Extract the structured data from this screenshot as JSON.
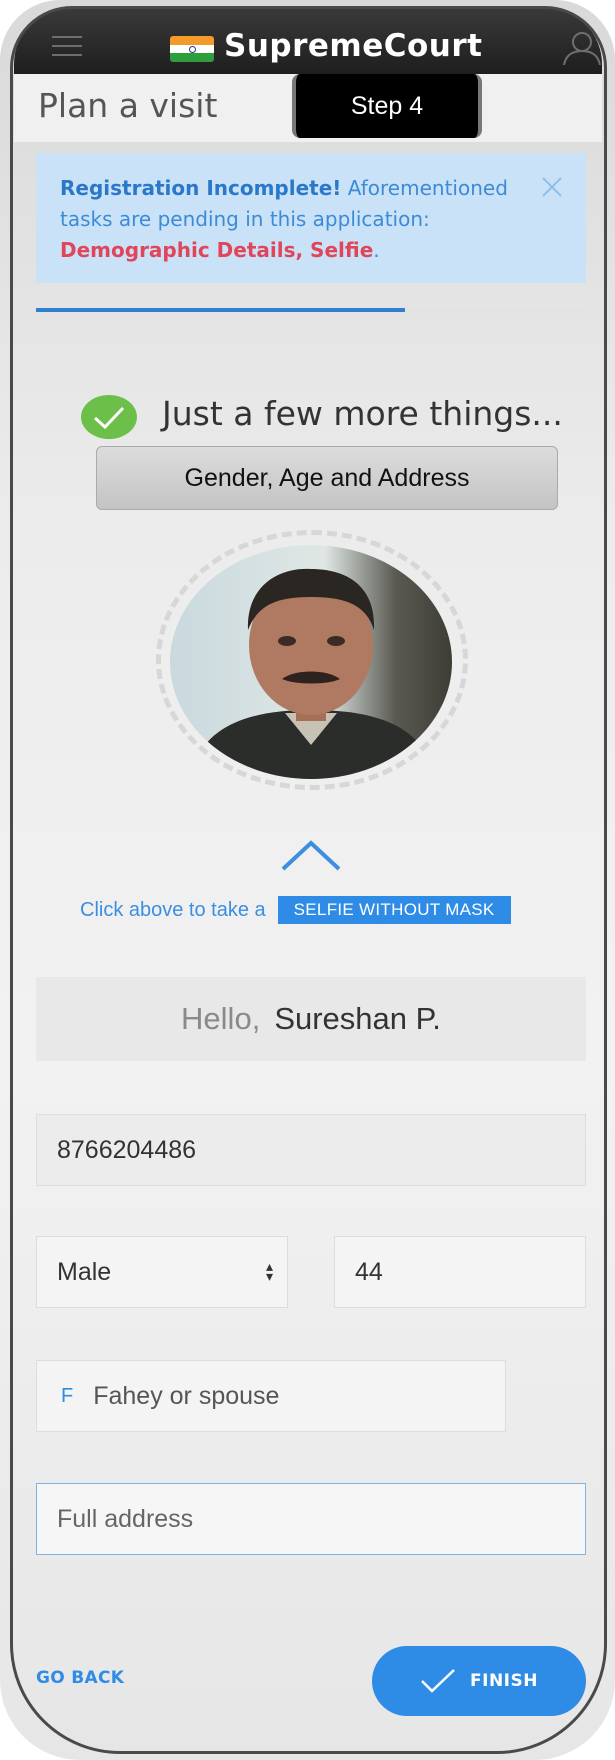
{
  "app": {
    "title": "SupremeCourt",
    "icons": {
      "menu": "hamburger-menu-icon",
      "flag": "india-flag-icon",
      "user": "user-profile-icon"
    }
  },
  "header": {
    "page_title": "Plan a visit",
    "step_badge": "Step 4"
  },
  "alert": {
    "heading": "Registration Incomplete!",
    "message": "Aforementioned tasks are pending in this application:",
    "pending_items": "Demographic Details, Selfie",
    "suffix": ".",
    "close_icon": "close-icon"
  },
  "progress": {
    "fraction": 0.67
  },
  "intro": {
    "title": "Just a few more things...",
    "tip": "Gender, Age and Address",
    "check_icon": "check-circle-icon"
  },
  "selfie": {
    "hint": "Click above to take a",
    "pill_label": "SELFIE WITHOUT MASK",
    "chevron_icon": "chevron-up-icon"
  },
  "greeting": {
    "hello": "Hello,",
    "name": "Sureshan P."
  },
  "form": {
    "phone_value": "8766204486",
    "gender_value": "Male",
    "age_value": "44",
    "guardian_prefix": "F",
    "guardian_placeholder": "Fahey or spouse",
    "address_placeholder": "Full address"
  },
  "footer": {
    "back_label": "GO BACK",
    "finish_label": "FINISH"
  },
  "colors": {
    "accent": "#2e8ce6",
    "alert_bg": "#c9e2f7",
    "alert_pending": "#e0455a",
    "success": "#6cc04a"
  }
}
